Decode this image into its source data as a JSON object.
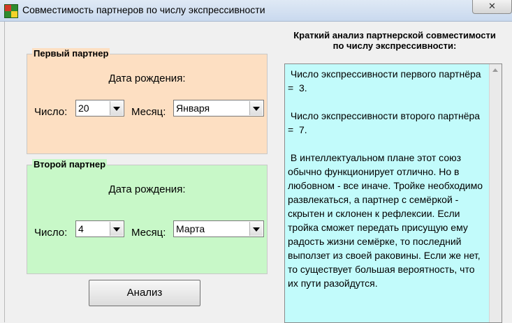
{
  "window": {
    "title": "Совместимость партнеров по числу экспрессивности",
    "close_label": "✕"
  },
  "partner1": {
    "legend": "Первый партнер",
    "dob_label": "Дата рождения:",
    "day_label": "Число:",
    "day_value": "20",
    "month_label": "Месяц:",
    "month_value": "Января"
  },
  "partner2": {
    "legend": "Второй партнер",
    "dob_label": "Дата рождения:",
    "day_label": "Число:",
    "day_value": "4",
    "month_label": "Месяц:",
    "month_value": "Марта"
  },
  "analyze_button": "Анализ",
  "result": {
    "title": "Краткий анализ партнерской совместимости по числу экспрессивности:",
    "text": " Число экспрессивности первого партнёра =  3.\n\n Число экспрессивности второго партнёра =  7.\n\n В интеллектуальном плане этот союз обычно функционирует отлично. Но в любовном - все иначе. Тройке необходимо развлекаться, а партнер с семёркой - скрытен и склонен к рефлексии. Если тройка сможет передать присущую ему радость жизни семёрке, то последний выползет из своей раковины. Если же нет, то существует большая вероятность, что их пути разойдутся."
  },
  "icons": {
    "app": "app-icon",
    "close": "close-icon",
    "dropdown": "chevron-down-icon",
    "scroll_up": "scroll-up-arrow-icon"
  }
}
